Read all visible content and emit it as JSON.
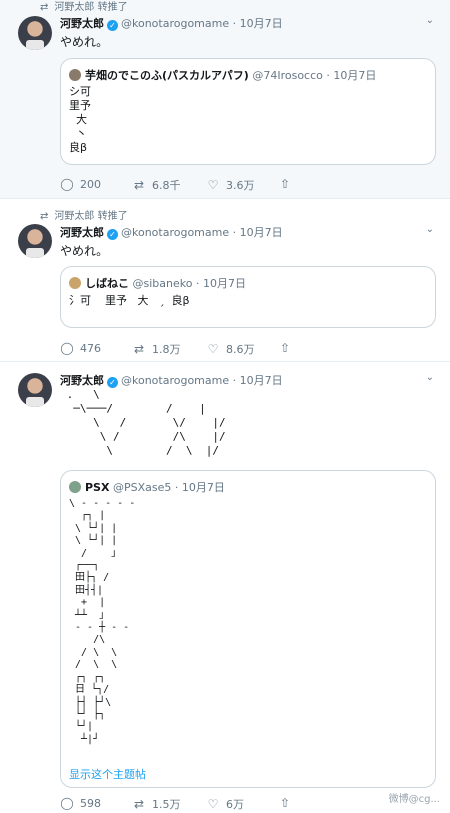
{
  "tweets": [
    {
      "retweet_label": "河野太郎 转推了",
      "name": "河野太郎",
      "handle": "@konotarogomame · 10月7日",
      "text": "やめれ。",
      "quote": {
        "name": "芋畑のでこのふ(パスカルアパフ)",
        "handle": "@74Irosocco · 10月7日",
        "text": "シ可\n里予\n  大\n  丶\n良β"
      },
      "actions": {
        "reply": "200",
        "retweet": "6.8千",
        "like": "3.6万"
      }
    },
    {
      "retweet_label": "河野太郎 转推了",
      "name": "河野太郎",
      "handle": "@konotarogomame · 10月7日",
      "text": "やめれ。",
      "quote": {
        "name": "しばねこ",
        "handle": "@sibaneko · 10月7日",
        "text": "氵可    里予   大   ˏ  良β"
      },
      "actions": {
        "reply": "476",
        "retweet": "1.8万",
        "like": "8.6万"
      }
    },
    {
      "name": "河野太郎",
      "handle": "@konotarogomame · 10月7日",
      "art": " .   \\\n  ─\\───/        /    |\n     \\   /       \\/    |/\n      \\ /        /\\    |/\n       \\        /  \\  |/",
      "quote": {
        "name": "PSX",
        "handle": "@PSXase5 · 10月7日",
        "art": "\\ - - - - -\n  ┌┐ |\n \\ └┘| |\n \\ └┘| |\n  /    」\n ┌──┐\n 田├┐ /\n 田┤┤|\n  +  |\n ┴┴  」\n - - ┼ - -\n    /\\\n  / \\  \\\n /  \\  \\\n ┌┐ ┌┐\n 日 └┐/\n ├┤ ├┘\\\n └┘ ├┐\n └┘|\n  ┴|┘",
        "show_thread": "显示这个主题帖"
      },
      "actions": {
        "reply": "598",
        "retweet": "1.5万",
        "like": "6万"
      }
    }
  ],
  "watermark": "微博@cg..."
}
